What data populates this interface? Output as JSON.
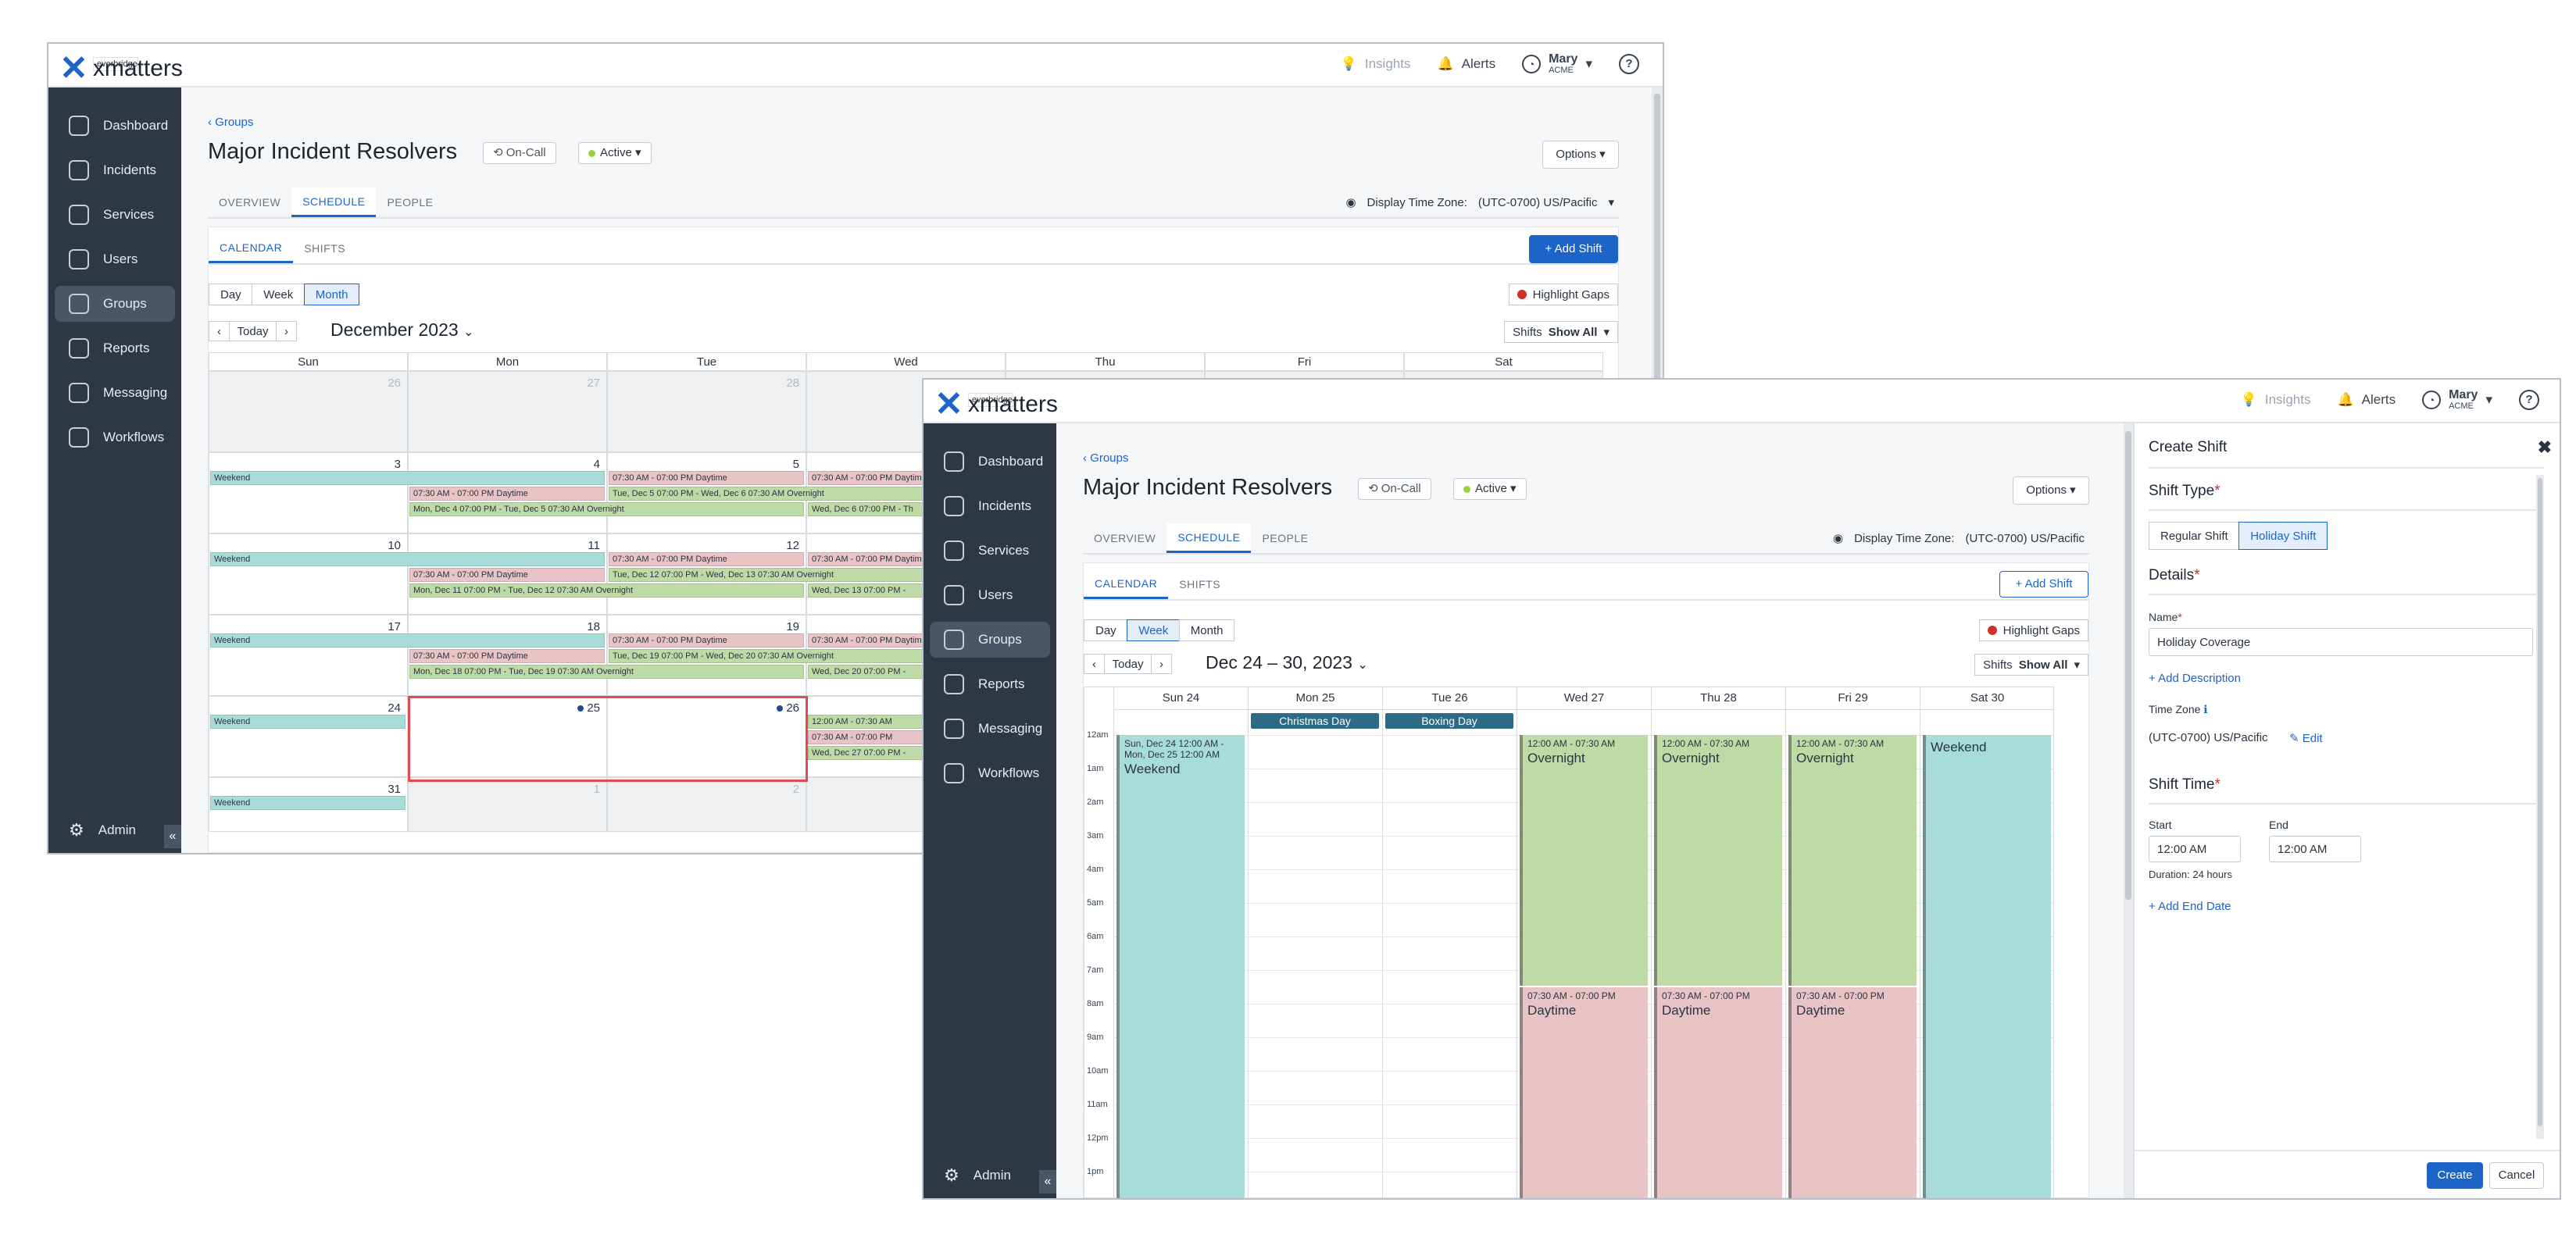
{
  "brand": {
    "over": "everbridge",
    "name": "xmatters"
  },
  "topbar": {
    "insights": "Insights",
    "alerts": "Alerts",
    "user_name": "Mary",
    "user_org": "ACME"
  },
  "nav": [
    "Dashboard",
    "Incidents",
    "Services",
    "Users",
    "Groups",
    "Reports",
    "Messaging",
    "Workflows"
  ],
  "nav_active": "Groups",
  "admin": "Admin",
  "page": {
    "breadcrumb": "‹ Groups",
    "title": "Major Incident Resolvers",
    "oncall": "On-Call",
    "status": "Active",
    "options": "Options"
  },
  "tabs": [
    "OVERVIEW",
    "SCHEDULE",
    "PEOPLE"
  ],
  "timezone": {
    "label": "Display Time Zone:",
    "value": "(UTC-0700) US/Pacific"
  },
  "subtabs": [
    "CALENDAR",
    "SHIFTS"
  ],
  "add_shift": "+  Add Shift",
  "views": [
    "Day",
    "Week",
    "Month"
  ],
  "highlight_gaps": "Highlight Gaps",
  "shifts_filter": {
    "label": "Shifts",
    "value": "Show All"
  },
  "nav_buttons": {
    "prev": "‹",
    "today": "Today",
    "next": "›"
  },
  "month_view": {
    "title": "December 2023",
    "weekdays": [
      "Sun",
      "Mon",
      "Tue",
      "Wed",
      "Thu",
      "Fri",
      "Sat"
    ],
    "rows": [
      [
        "26",
        "27",
        "28",
        "",
        "",
        "",
        ""
      ],
      [
        "3",
        "4",
        "5",
        "",
        "",
        "",
        ""
      ],
      [
        "10",
        "11",
        "12",
        "",
        "",
        "",
        ""
      ],
      [
        "17",
        "18",
        "19",
        "",
        "",
        "",
        ""
      ],
      [
        "24",
        "25",
        "26",
        "",
        "",
        "",
        ""
      ],
      [
        "31",
        "1",
        "2",
        "",
        "",
        "",
        ""
      ]
    ],
    "events": {
      "weekend": "Weekend",
      "daytime": "07:30 AM - 07:00 PM  Daytime",
      "day_short": "07:30 AM - 07:00 PM",
      "w1_mon_ov": "Mon, Dec 4 07:00 PM - Tue, Dec 5 07:30 AM  Overnight",
      "w1_tue_ov": "Tue, Dec 5 07:00 PM - Wed, Dec 6 07:30 AM  Overnight",
      "w1_wed_ov": "Wed, Dec 6 07:00 PM - Th",
      "w2_mon_ov": "Mon, Dec 11 07:00 PM - Tue, Dec 12 07:30 AM  Overnight",
      "w2_tue_ov": "Tue, Dec 12 07:00 PM - Wed, Dec 13 07:30 AM  Overnight",
      "w2_wed_ov": "Wed, Dec 13 07:00 PM -",
      "w3_mon_ov": "Mon, Dec 18 07:00 PM - Tue, Dec 19 07:30 AM  Overnight",
      "w3_tue_ov": "Tue, Dec 19 07:00 PM - Wed, Dec 20 07:30 AM  Overnight",
      "w3_wed_ov": "Wed, Dec 20 07:00 PM -",
      "w4_a": "12:00 AM - 07:30 AM",
      "w4_b": "07:30 AM - 07:00 PM",
      "w4_c": "Wed, Dec 27 07:00 PM -"
    }
  },
  "week_view": {
    "title": "Dec 24 – 30, 2023",
    "days": [
      "Sun 24",
      "Mon 25",
      "Tue 26",
      "Wed 27",
      "Thu 28",
      "Fri 29",
      "Sat 30"
    ],
    "holidays": [
      "Christmas Day",
      "Boxing Day"
    ],
    "hours": [
      "12am",
      "1am",
      "2am",
      "3am",
      "4am",
      "5am",
      "6am",
      "7am",
      "8am",
      "9am",
      "10am",
      "11am",
      "12pm",
      "1pm"
    ],
    "weekend_time": "Sun, Dec 24 12:00 AM - Mon, Dec 25 12:00 AM",
    "weekend": "Weekend",
    "overnight_time": "12:00 AM - 07:30 AM",
    "overnight": "Overnight",
    "daytime_time": "07:30 AM - 07:00 PM",
    "daytime": "Daytime"
  },
  "drawer": {
    "title": "Create Shift",
    "shift_type_label": "Shift Type",
    "types": [
      "Regular Shift",
      "Holiday Shift"
    ],
    "active_type": "Holiday Shift",
    "details": "Details",
    "name_label": "Name",
    "name_value": "Holiday Coverage",
    "add_description": "+  Add Description",
    "timezone_label": "Time Zone",
    "timezone_value": "(UTC-0700) US/Pacific",
    "edit": "Edit",
    "shift_time": "Shift Time",
    "start_label": "Start",
    "end_label": "End",
    "start_value": "12:00 AM",
    "end_value": "12:00 AM",
    "duration": "Duration: 24 hours",
    "add_end_date": "+  Add End Date",
    "create": "Create",
    "cancel": "Cancel"
  },
  "colors": {
    "accent": "#1d64c8",
    "weekend": "#a8dcd9",
    "daytime": "#e8c4c6",
    "overnight": "#bedaa6",
    "holiday": "#2d6a86",
    "sidebar": "#2e3744",
    "gap": "#e04a50"
  }
}
